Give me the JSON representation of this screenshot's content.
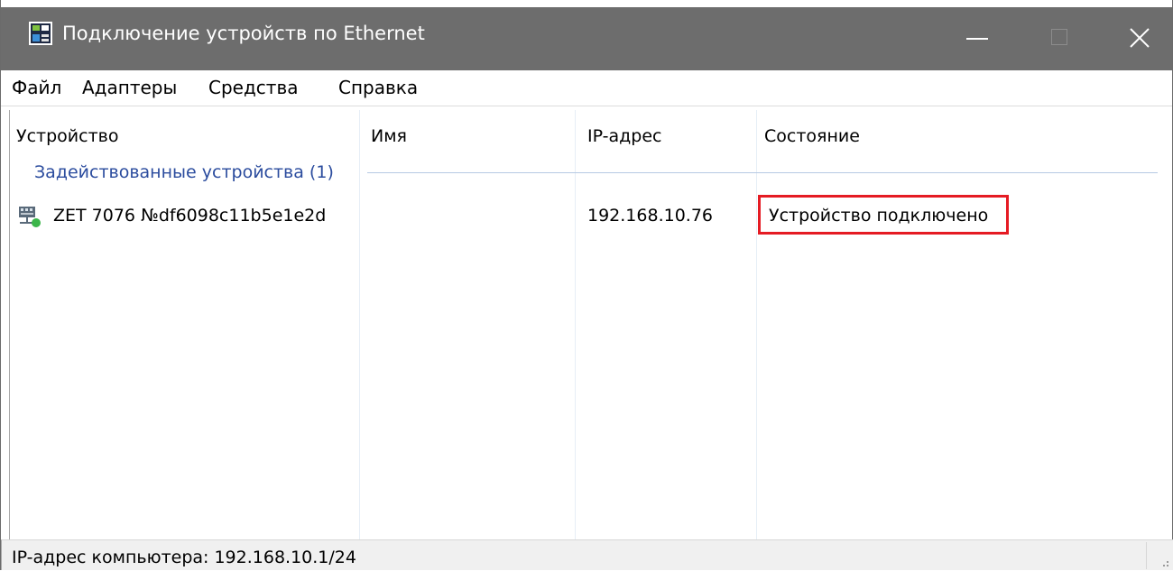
{
  "window": {
    "title": "Подключение устройств по Ethernet",
    "title_bar_color": "#6d6d6d",
    "controls": {
      "minimize_icon": "minimize-icon",
      "maximize_icon": "maximize-icon",
      "close_icon": "close-icon"
    }
  },
  "menu": {
    "items": [
      "Файл",
      "Адаптеры",
      "Средства",
      "Справка"
    ]
  },
  "table": {
    "columns": [
      "Устройство",
      "Имя",
      "IP-адрес",
      "Состояние"
    ],
    "group": {
      "label": "Задействованные устройства (1)",
      "color": "#2b4c9e"
    },
    "rows": [
      {
        "icon": "network-device-icon",
        "device": "ZET 7076 №df6098c11b5e1e2d",
        "name": "",
        "ip": "192.168.10.76",
        "status": "Устройство подключено"
      }
    ],
    "highlight_color": "#e51b23"
  },
  "statusbar": {
    "text": "IP-адрес компьютера: 192.168.10.1/24"
  }
}
